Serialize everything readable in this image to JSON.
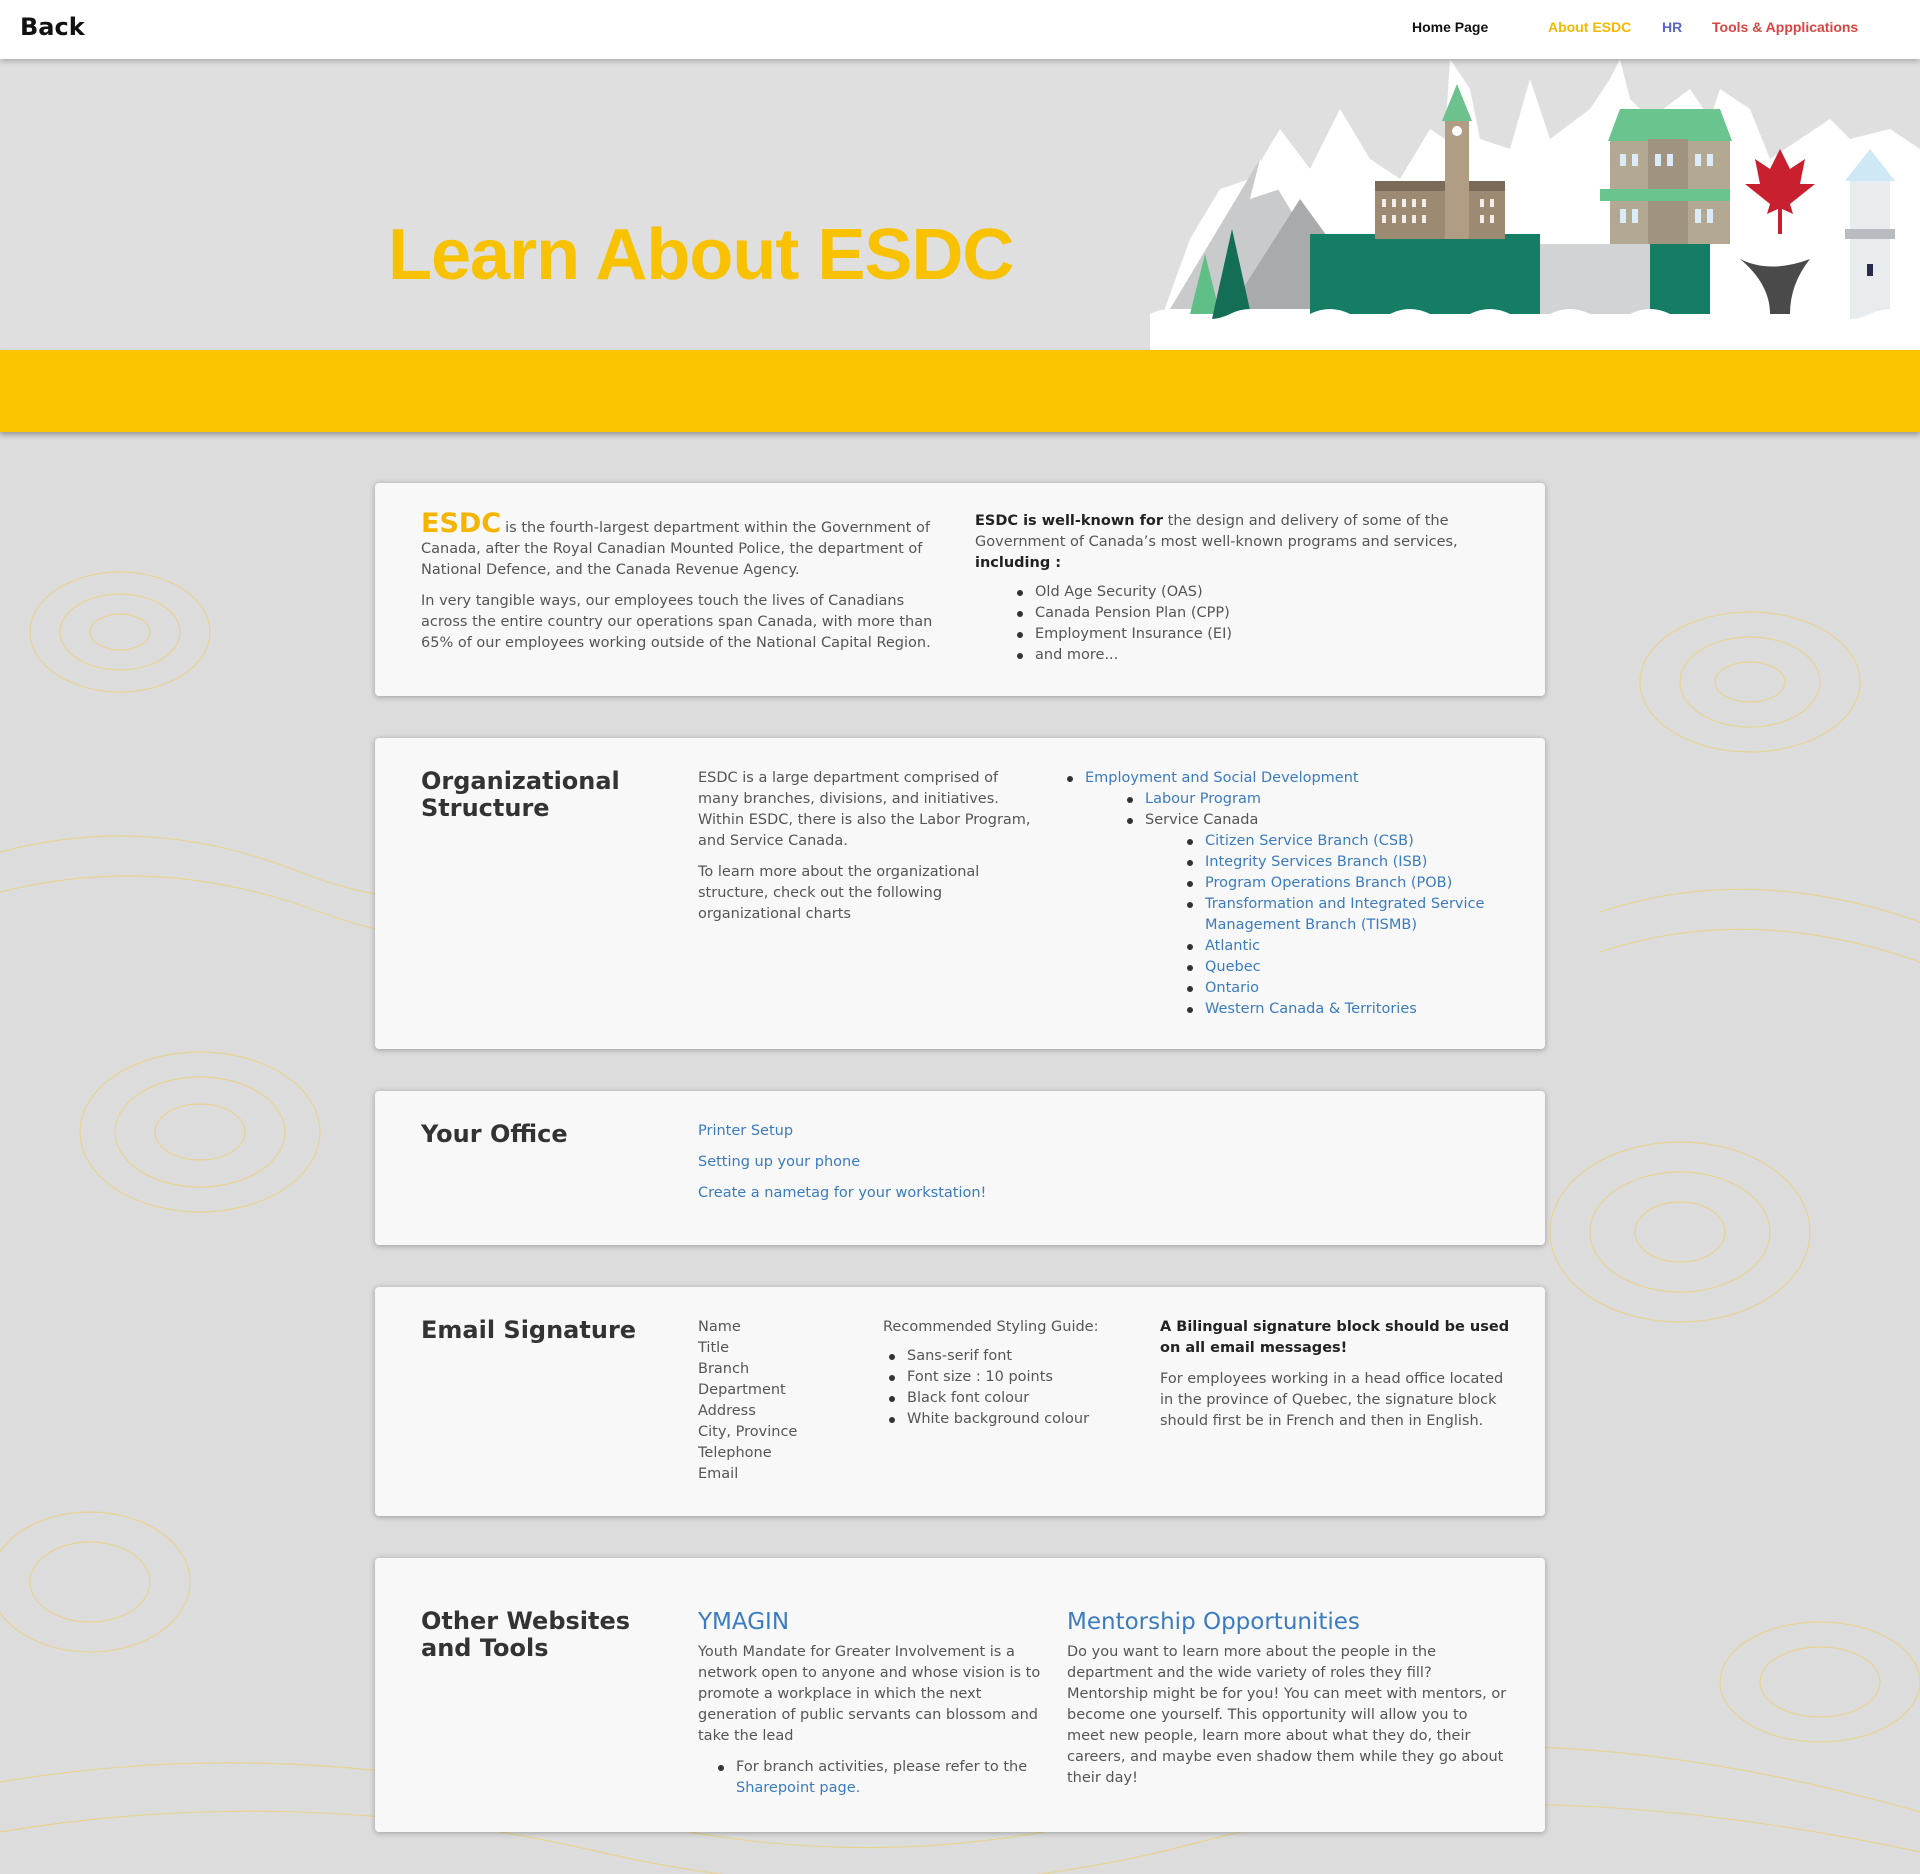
{
  "nav": {
    "back": "Back",
    "home": "Home Page",
    "about": "About ESDC",
    "hr": "HR",
    "tools": "Tools & Appplications"
  },
  "hero": {
    "title": "Learn About ESDC"
  },
  "intro": {
    "esdc": "ESDC",
    "p1_rest": "is the fourth-largest department within the Government of Canada, after the Royal Canadian Mounted Police, the department of National Defence, and the Canada Revenue Agency.",
    "p2": "In very tangible ways, our employees touch the lives of Canadians across the entire country our operations span Canada, with more than 65% of our employees working outside of the National Capital Region.",
    "known_bold": "ESDC is well-known for",
    "known_rest": "the design and delivery of some of the Government of Canada’s most well-known programs and services,",
    "including": "including :",
    "programs": [
      "Old Age Security (OAS)",
      "Canada Pension Plan (CPP)",
      "Employment Insurance (EI)",
      "and more..."
    ]
  },
  "org": {
    "title": "Organizational Structure",
    "p1": "ESDC is a large department comprised of many branches, divisions, and initiatives. Within ESDC, there is also the Labor Program, and Service Canada.",
    "p2": "To learn more about the organizational structure, check out the following organizational charts",
    "root": "Employment and Social Development",
    "labour": "Labour Program",
    "service": "Service Canada",
    "branches": [
      "Citizen Service Branch (CSB)",
      "Integrity Services Branch (ISB)",
      "Program Operations Branch (POB)",
      "Transformation and Integrated Service Management Branch (TISMB)",
      "Atlantic",
      "Quebec",
      "Ontario",
      "Western Canada & Territories"
    ]
  },
  "office": {
    "title": "Your Office",
    "links": [
      "Printer Setup",
      "Setting up your phone",
      "Create a nametag for your workstation!"
    ]
  },
  "email": {
    "title": "Email Signature",
    "fields": [
      "Name",
      "Title",
      "Branch",
      "Department",
      "Address",
      "City, Province",
      "Telephone",
      "Email"
    ],
    "guide_title": "Recommended Styling Guide:",
    "guide": [
      "Sans-serif font",
      "Font size : 10 points",
      "Black font colour",
      "White background colour"
    ],
    "bilingual": "A Bilingual signature block should be used on all email messages!",
    "quebec": "For employees working in a head office located in the province of Quebec, the signature block should first be in French and then in English."
  },
  "other": {
    "title": "Other Websites and Tools",
    "ymagin_title": "YMAGIN",
    "ymagin_text": "Youth Mandate for Greater Involvement is a network open to anyone and whose vision is to promote a workplace in which the next generation of public servants can blossom and take the lead",
    "branch_text": "For branch activities, please refer to the",
    "sharepoint": "Sharepoint page.",
    "mentor_title": "Mentorship Opportunities",
    "mentor_text": "Do you want to learn more about the people in the department and the wide variety of roles they fill? Mentorship might be for you! You can meet with mentors, or become one yourself. This opportunity will allow you to meet new people, learn more about what they do, their careers, and maybe even shadow them while they go about their day!"
  },
  "colors": {
    "accent_yellow": "#fbc500",
    "title_yellow": "#f8c200",
    "link_blue": "#3b7bbf",
    "hr_blue": "#5a67c9",
    "tools_red": "#d9443e"
  }
}
